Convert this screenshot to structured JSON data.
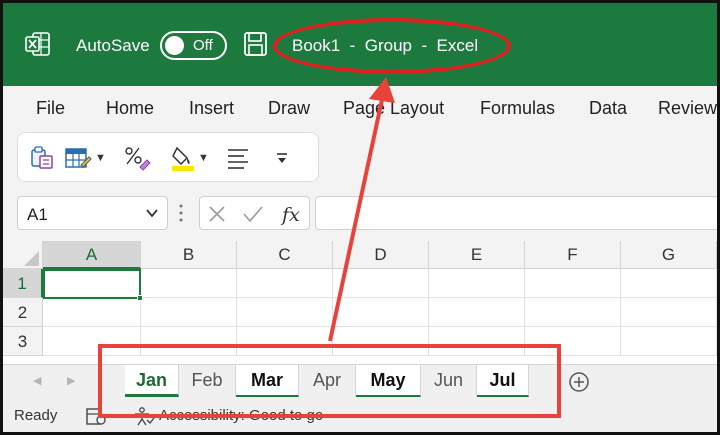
{
  "titlebar": {
    "autosave_label": "AutoSave",
    "autosave_state": "Off",
    "document_title": "Book1  -  Group  -  Excel",
    "bg_color": "#1d7a3f"
  },
  "menu": {
    "items": [
      "File",
      "Home",
      "Insert",
      "Draw",
      "Page Layout",
      "Formulas",
      "Data",
      "Review"
    ]
  },
  "toolbar": {
    "icons": [
      "paste-special-icon",
      "format-table-icon",
      "number-format-icon",
      "fill-color-icon",
      "align-icon",
      "more-icon"
    ]
  },
  "formula_bar": {
    "name_box": "A1",
    "formula_value": ""
  },
  "grid": {
    "columns": [
      "A",
      "B",
      "C",
      "D",
      "E",
      "F",
      "G"
    ],
    "rows": [
      "1",
      "2",
      "3"
    ],
    "active_cell": "A1"
  },
  "sheets": {
    "tabs": [
      {
        "name": "Jan",
        "state": "active"
      },
      {
        "name": "Feb",
        "state": "normal"
      },
      {
        "name": "Mar",
        "state": "grouped"
      },
      {
        "name": "Apr",
        "state": "normal"
      },
      {
        "name": "May",
        "state": "grouped"
      },
      {
        "name": "Jun",
        "state": "normal"
      },
      {
        "name": "Jul",
        "state": "grouped"
      }
    ]
  },
  "statusbar": {
    "ready": "Ready",
    "accessibility": "Accessibility: Good to go"
  },
  "annotation": {
    "color": "#e02020"
  }
}
